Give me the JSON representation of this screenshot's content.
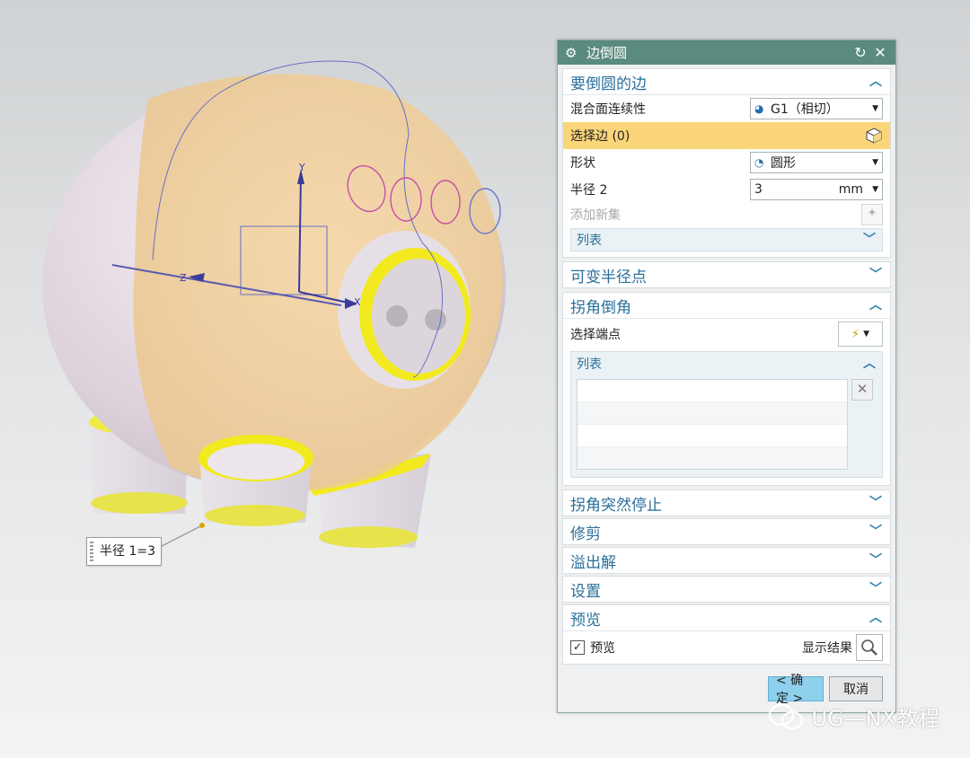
{
  "dialog": {
    "title": "边倒圆",
    "reset_icon": "reset-icon",
    "close_icon": "close-icon",
    "sections": {
      "edges": {
        "label": "要倒圆的边",
        "blend_continuity_label": "混合面连续性",
        "blend_continuity_value": "G1（相切）",
        "select_edge_label": "选择边 (0)",
        "shape_label": "形状",
        "shape_value": "圆形",
        "radius_label": "半径 2",
        "radius_value": "3",
        "radius_unit": "mm",
        "add_new_set_label": "添加新集",
        "list_label": "列表"
      },
      "variable_radius": {
        "label": "可变半径点"
      },
      "corner_setback": {
        "label": "拐角倒角",
        "select_endpoint_label": "选择端点",
        "list_label": "列表"
      },
      "stop_short": {
        "label": "拐角突然停止"
      },
      "trim": {
        "label": "修剪"
      },
      "overflow": {
        "label": "溢出解"
      },
      "settings": {
        "label": "设置"
      },
      "preview": {
        "label": "预览",
        "checkbox_label": "预览",
        "checked": true,
        "show_result_label": "显示结果"
      }
    },
    "buttons": {
      "ok": "< 确定 >",
      "cancel": "取消"
    }
  },
  "viewport": {
    "radius_tag": "半径 1=3",
    "axis_y": "Y",
    "axis_z": "Z",
    "axis_x": "X"
  },
  "watermark": "UG—NX教程",
  "colors": {
    "titlebar": "#5b8a7e",
    "section_header_text": "#2a6f9a",
    "selected_row": "#fbd57a",
    "ok_button": "#8fd0ec",
    "fillet_highlight": "#f2ea1e"
  }
}
